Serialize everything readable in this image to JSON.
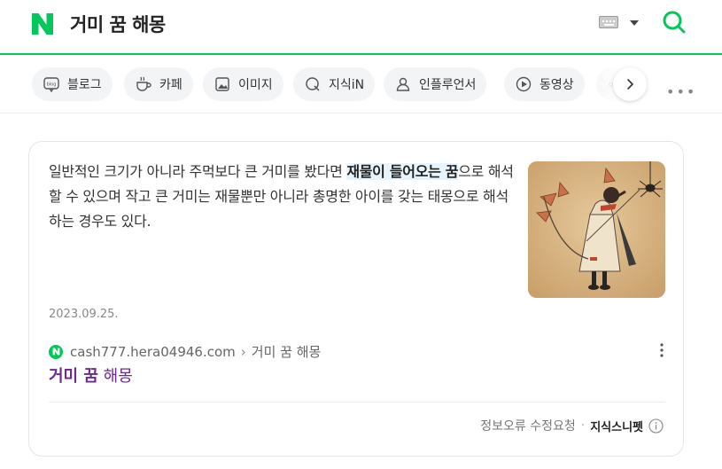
{
  "header": {
    "query": "거미 꿈 해몽",
    "brand_color": "#03c75a"
  },
  "tabs": [
    {
      "label": "블로그",
      "icon": "blog-icon"
    },
    {
      "label": "카페",
      "icon": "cafe-icon"
    },
    {
      "label": "이미지",
      "icon": "image-icon"
    },
    {
      "label": "지식iN",
      "icon": "kin-icon"
    },
    {
      "label": "인플루언서",
      "icon": "person-icon"
    },
    {
      "label": "동영상",
      "icon": "play-icon"
    }
  ],
  "card": {
    "snippet_before": "일반적인 크기가 아니라 주먹보다 큰 거미를 봤다면 ",
    "snippet_highlight": "재물이 들어오는 꿈",
    "snippet_after": "으로 해석할 수 있으며 작고 큰 거미는 재물뿐만 아니라 총명한 아이를 갖는 태몽으로 해석하는 경우도 있다.",
    "date": "2023.09.25.",
    "source_url": "cash777.hera04946.com",
    "source_path": "거미 꿈 해몽",
    "title_bold": "거미 꿈",
    "title_rest": " 해몽",
    "title_color": "#6b2a8f",
    "footer_report": "정보오류 수정요청",
    "footer_brand": "지식스니펫"
  }
}
